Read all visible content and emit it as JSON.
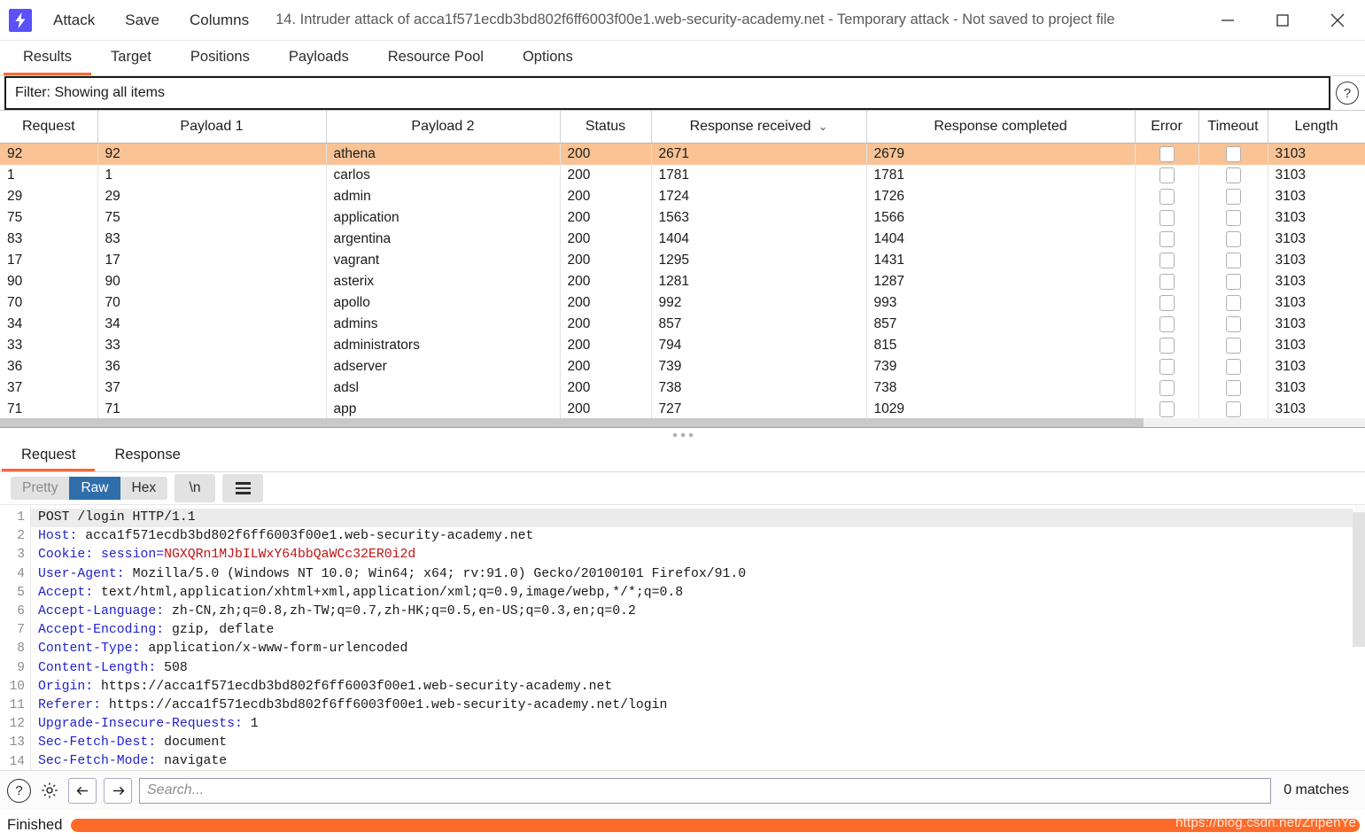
{
  "titlebar": {
    "logo_icon": "lightning-bolt-icon",
    "menus": [
      "Attack",
      "Save",
      "Columns"
    ],
    "title": "14. Intruder attack of acca1f571ecdb3bd802f6ff6003f00e1.web-security-academy.net - Temporary attack - Not saved to project file",
    "minimize_label": "minimize-icon",
    "maximize_label": "maximize-icon",
    "close_label": "close-icon"
  },
  "tabs": {
    "items": [
      "Results",
      "Target",
      "Positions",
      "Payloads",
      "Resource Pool",
      "Options"
    ],
    "active": "Results"
  },
  "filter": {
    "text": "Filter: Showing all items",
    "help_icon": "question-mark-icon"
  },
  "results_table": {
    "columns": [
      "Request",
      "Payload 1",
      "Payload 2",
      "Status",
      "Response received",
      "Response completed",
      "Error",
      "Timeout",
      "Length"
    ],
    "sorted_column": "Response received",
    "sort_direction": "descending",
    "rows": [
      {
        "request": "92",
        "payload1": "92",
        "payload2": "athena",
        "status": "200",
        "received": "2671",
        "completed": "2679",
        "error": false,
        "timeout": false,
        "length": "3103",
        "selected": true
      },
      {
        "request": "1",
        "payload1": "1",
        "payload2": "carlos",
        "status": "200",
        "received": "1781",
        "completed": "1781",
        "error": false,
        "timeout": false,
        "length": "3103",
        "selected": false
      },
      {
        "request": "29",
        "payload1": "29",
        "payload2": "admin",
        "status": "200",
        "received": "1724",
        "completed": "1726",
        "error": false,
        "timeout": false,
        "length": "3103",
        "selected": false
      },
      {
        "request": "75",
        "payload1": "75",
        "payload2": "application",
        "status": "200",
        "received": "1563",
        "completed": "1566",
        "error": false,
        "timeout": false,
        "length": "3103",
        "selected": false
      },
      {
        "request": "83",
        "payload1": "83",
        "payload2": "argentina",
        "status": "200",
        "received": "1404",
        "completed": "1404",
        "error": false,
        "timeout": false,
        "length": "3103",
        "selected": false
      },
      {
        "request": "17",
        "payload1": "17",
        "payload2": "vagrant",
        "status": "200",
        "received": "1295",
        "completed": "1431",
        "error": false,
        "timeout": false,
        "length": "3103",
        "selected": false
      },
      {
        "request": "90",
        "payload1": "90",
        "payload2": "asterix",
        "status": "200",
        "received": "1281",
        "completed": "1287",
        "error": false,
        "timeout": false,
        "length": "3103",
        "selected": false
      },
      {
        "request": "70",
        "payload1": "70",
        "payload2": "apollo",
        "status": "200",
        "received": "992",
        "completed": "993",
        "error": false,
        "timeout": false,
        "length": "3103",
        "selected": false
      },
      {
        "request": "34",
        "payload1": "34",
        "payload2": "admins",
        "status": "200",
        "received": "857",
        "completed": "857",
        "error": false,
        "timeout": false,
        "length": "3103",
        "selected": false
      },
      {
        "request": "33",
        "payload1": "33",
        "payload2": "administrators",
        "status": "200",
        "received": "794",
        "completed": "815",
        "error": false,
        "timeout": false,
        "length": "3103",
        "selected": false
      },
      {
        "request": "36",
        "payload1": "36",
        "payload2": "adserver",
        "status": "200",
        "received": "739",
        "completed": "739",
        "error": false,
        "timeout": false,
        "length": "3103",
        "selected": false
      },
      {
        "request": "37",
        "payload1": "37",
        "payload2": "adsl",
        "status": "200",
        "received": "738",
        "completed": "738",
        "error": false,
        "timeout": false,
        "length": "3103",
        "selected": false
      },
      {
        "request": "71",
        "payload1": "71",
        "payload2": "app",
        "status": "200",
        "received": "727",
        "completed": "1029",
        "error": false,
        "timeout": false,
        "length": "3103",
        "selected": false
      }
    ]
  },
  "message_tabs": {
    "items": [
      "Request",
      "Response"
    ],
    "active": "Request"
  },
  "viewbar": {
    "pretty": "Pretty",
    "raw": "Raw",
    "hex": "Hex",
    "newline": "\\n",
    "menu_icon": "hamburger-menu-icon",
    "active": "Raw"
  },
  "request": {
    "lines": [
      {
        "n": "1",
        "text": "POST /login HTTP/1.1"
      },
      {
        "n": "2",
        "name": "Host",
        "value": "acca1f571ecdb3bd802f6ff6003f00e1.web-security-academy.net"
      },
      {
        "n": "3",
        "name": "Cookie",
        "cookie_name": "session",
        "cookie_value": "NGXQRn1MJbILWxY64bbQaWCc32ER0i2d"
      },
      {
        "n": "4",
        "name": "User-Agent",
        "value": "Mozilla/5.0 (Windows NT 10.0; Win64; x64; rv:91.0) Gecko/20100101 Firefox/91.0"
      },
      {
        "n": "5",
        "name": "Accept",
        "value": "text/html,application/xhtml+xml,application/xml;q=0.9,image/webp,*/*;q=0.8"
      },
      {
        "n": "6",
        "name": "Accept-Language",
        "value": "zh-CN,zh;q=0.8,zh-TW;q=0.7,zh-HK;q=0.5,en-US;q=0.3,en;q=0.2"
      },
      {
        "n": "7",
        "name": "Accept-Encoding",
        "value": "gzip, deflate"
      },
      {
        "n": "8",
        "name": "Content-Type",
        "value": "application/x-www-form-urlencoded"
      },
      {
        "n": "9",
        "name": "Content-Length",
        "value": "508"
      },
      {
        "n": "10",
        "name": "Origin",
        "value": "https://acca1f571ecdb3bd802f6ff6003f00e1.web-security-academy.net"
      },
      {
        "n": "11",
        "name": "Referer",
        "value": "https://acca1f571ecdb3bd802f6ff6003f00e1.web-security-academy.net/login"
      },
      {
        "n": "12",
        "name": "Upgrade-Insecure-Requests",
        "value": "1"
      },
      {
        "n": "13",
        "name": "Sec-Fetch-Dest",
        "value": "document"
      },
      {
        "n": "14",
        "name": "Sec-Fetch-Mode",
        "value": "navigate"
      }
    ]
  },
  "search": {
    "help_icon": "question-mark-icon",
    "settings_icon": "gear-icon",
    "prev_icon": "arrow-left-icon",
    "next_icon": "arrow-right-icon",
    "placeholder": "Search...",
    "value": "",
    "matches": "0 matches"
  },
  "statusbar": {
    "status": "Finished",
    "progress_percent": 100,
    "watermark": "https://blog.csdn.net/ZripenYe"
  },
  "colors": {
    "accent": "#ff6633",
    "selection": "#f9c395",
    "progress": "#ff6a28",
    "logo": "#5b51f8",
    "active_seg": "#2f6eab"
  }
}
